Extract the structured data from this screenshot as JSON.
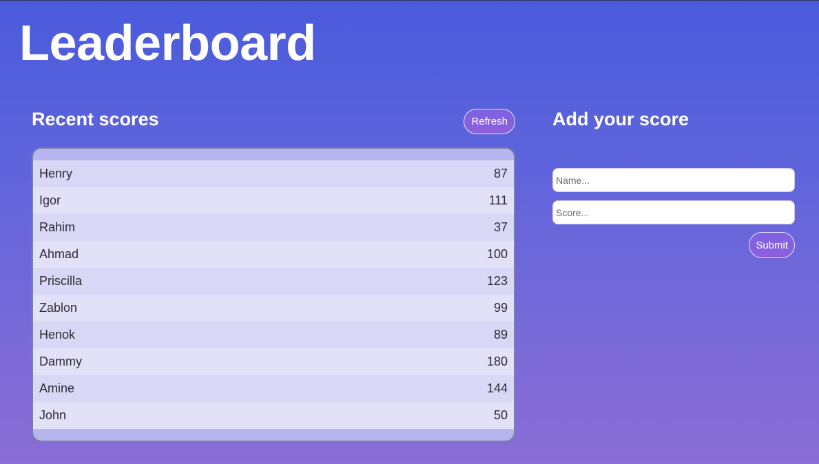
{
  "app": {
    "title": "Leaderboard"
  },
  "recent_scores": {
    "heading": "Recent scores",
    "refresh_label": "Refresh",
    "rows": [
      {
        "name": "Henry",
        "score": "87"
      },
      {
        "name": "Igor",
        "score": "111"
      },
      {
        "name": "Rahim",
        "score": "37"
      },
      {
        "name": "Ahmad",
        "score": "100"
      },
      {
        "name": "Priscilla",
        "score": "123"
      },
      {
        "name": "Zablon",
        "score": "99"
      },
      {
        "name": "Henok",
        "score": "89"
      },
      {
        "name": "Dammy",
        "score": "180"
      },
      {
        "name": "Amine",
        "score": "144"
      },
      {
        "name": "John",
        "score": "50"
      }
    ]
  },
  "add_score": {
    "heading": "Add your score",
    "name_input": {
      "value": "",
      "placeholder": "Name..."
    },
    "score_input": {
      "value": "",
      "placeholder": "Score..."
    },
    "submit_label": "Submit"
  },
  "colors": {
    "background_top": "#4a5bdc",
    "background_bottom": "#8a6dd6",
    "button_accent": "#8e5fdf",
    "table_frame": "#b6b5ee",
    "row_odd": "#d8d7f5",
    "row_even": "#e2e1f7"
  }
}
